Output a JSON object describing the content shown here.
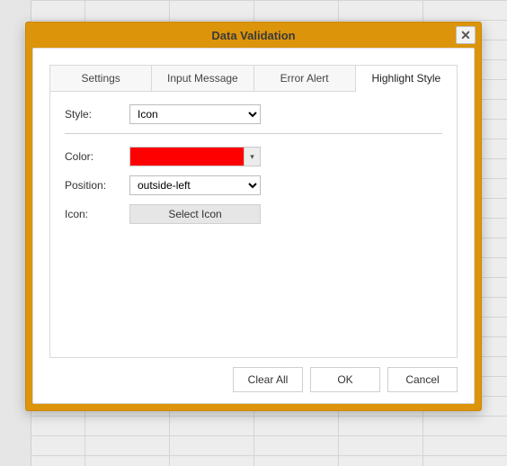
{
  "dialog": {
    "title": "Data Validation",
    "tabs": [
      {
        "label": "Settings"
      },
      {
        "label": "Input Message"
      },
      {
        "label": "Error Alert"
      },
      {
        "label": "Highlight Style"
      }
    ],
    "active_tab_index": 3,
    "form": {
      "style_label": "Style:",
      "style_value": "Icon",
      "color_label": "Color:",
      "color_value": "#ff0000",
      "position_label": "Position:",
      "position_value": "outside-left",
      "icon_label": "Icon:",
      "select_icon_button": "Select Icon"
    },
    "buttons": {
      "clear_all": "Clear All",
      "ok": "OK",
      "cancel": "Cancel"
    }
  }
}
